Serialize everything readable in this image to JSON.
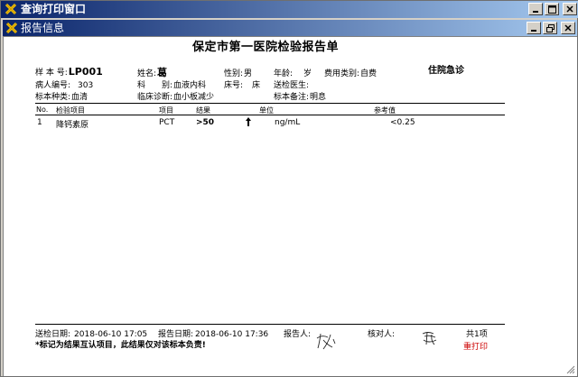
{
  "window": {
    "title": "查询打印窗口"
  },
  "child_window": {
    "title": "报告信息"
  },
  "report": {
    "title": "保定市第一医院检验报告单",
    "ward": "住院急诊",
    "header": {
      "sample_no_label": "样 本 号:",
      "sample_no": "LP001",
      "name_label": "姓名:",
      "name": "葛",
      "sex_label": "性别:",
      "sex": "男",
      "age_label": "年龄:",
      "age_unit": "岁",
      "fee_type_label": "费用类别:",
      "fee_type": "自费",
      "patient_no_label": "病人编号:",
      "patient_no": "303",
      "dept_label": "科　　别:",
      "dept": "血液内科",
      "bed_label": "床号:",
      "bed_unit": "床",
      "doctor_label": "送检医生:",
      "specimen_label": "标本种类:",
      "specimen": "血清",
      "diagnosis_label": "临床诊断:",
      "diagnosis": "血小板减少",
      "remark_label": "标本备注:",
      "remark": "明息"
    },
    "columns": [
      "No.",
      "检验项目",
      "项目",
      "结果",
      "单位",
      "参考值"
    ],
    "rows": [
      {
        "no": "1",
        "item_name": "降钙素原",
        "code": "PCT",
        "result": ">50",
        "flag": "high-arrow-icon",
        "unit": "ng/mL",
        "reference": "<0.25"
      }
    ],
    "footer": {
      "submit_date_label": "送检日期:",
      "submit_date": "2018-06-10 17:05",
      "report_date_label": "报告日期:",
      "report_date": "2018-06-10 17:36",
      "reporter_label": "报告人:",
      "checker_label": "核对人:",
      "page_count": "共1项",
      "disclaimer": "*标记为结果互认项目，此结果仅对该标本负责!",
      "reprint": "重打印"
    }
  }
}
